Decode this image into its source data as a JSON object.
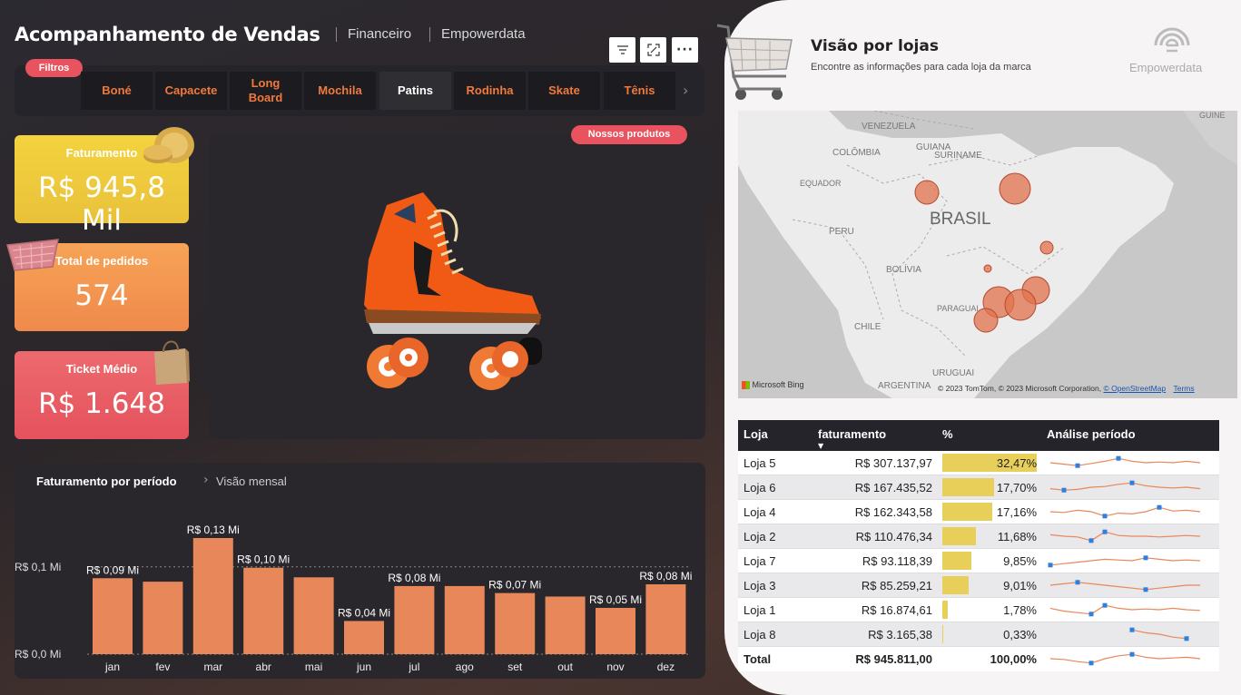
{
  "header": {
    "title": "Acompanhamento de Vendas",
    "crumbs": [
      "Financeiro",
      "Empowerdata"
    ]
  },
  "filters": {
    "badge": "Filtros",
    "tabs": [
      "Boné",
      "Capacete",
      "Long Board",
      "Mochila",
      "Patins",
      "Rodinha",
      "Skate",
      "Tênis"
    ],
    "active": "Patins"
  },
  "kpis": {
    "faturamento": {
      "label": "Faturamento",
      "value": "R$ 945,8 Mil"
    },
    "pedidos": {
      "label": "Total de pedidos",
      "value": "574"
    },
    "ticket": {
      "label": "Ticket Médio",
      "value": "R$ 1.648"
    }
  },
  "product": {
    "badge": "Nossos produtos"
  },
  "chart_panel": {
    "title": "Faturamento por período",
    "subtitle": "Visão mensal"
  },
  "chart_data": {
    "type": "bar",
    "categories": [
      "jan",
      "fev",
      "mar",
      "abr",
      "mai",
      "jun",
      "jul",
      "ago",
      "set",
      "out",
      "nov",
      "dez"
    ],
    "values": [
      0.087,
      0.083,
      0.133,
      0.099,
      0.088,
      0.038,
      0.078,
      0.078,
      0.07,
      0.066,
      0.053,
      0.08
    ],
    "data_labels": [
      "R$ 0,09 Mi",
      "",
      "R$ 0,13 Mi",
      "R$ 0,10 Mi",
      "",
      "R$ 0,04 Mi",
      "R$ 0,08 Mi",
      "",
      "R$ 0,07 Mi",
      "",
      "R$ 0,05 Mi",
      "R$ 0,08 Mi"
    ],
    "ytick_labels": [
      "R$ 0,0 Mi",
      "R$ 0,1 Mi"
    ],
    "yticks": [
      0,
      0.1
    ],
    "ylim": [
      0,
      0.133
    ],
    "color": "#e8885a"
  },
  "right": {
    "title": "Visão por lojas",
    "subtitle": "Encontre as informações para cada loja da marca",
    "brand": "Empowerdata"
  },
  "map": {
    "labels": [
      "VENEZUELA",
      "COLÔMBIA",
      "GUIANA",
      "SURINAME",
      "GUINE",
      "EQUADOR",
      "PERU",
      "BRASIL",
      "BOLÍVIA",
      "PARAGUAI",
      "CHILE",
      "ARGENTINA",
      "URUGUAI"
    ],
    "provider": "Microsoft Bing",
    "attribution": "© 2023 TomTom, © 2023 Microsoft Corporation,",
    "osm": "© OpenStreetMap",
    "terms": "Terms"
  },
  "table": {
    "headers": [
      "Loja",
      "faturamento",
      "%",
      "Análise período"
    ],
    "rows": [
      {
        "loja": "Loja 5",
        "fat": "R$ 307.137,97",
        "pct": "32,47%",
        "p": 32.47
      },
      {
        "loja": "Loja 6",
        "fat": "R$ 167.435,52",
        "pct": "17,70%",
        "p": 17.7
      },
      {
        "loja": "Loja 4",
        "fat": "R$ 162.343,58",
        "pct": "17,16%",
        "p": 17.16
      },
      {
        "loja": "Loja 2",
        "fat": "R$ 110.476,34",
        "pct": "11,68%",
        "p": 11.68
      },
      {
        "loja": "Loja 7",
        "fat": "R$ 93.118,39",
        "pct": "9,85%",
        "p": 9.85
      },
      {
        "loja": "Loja 3",
        "fat": "R$ 85.259,21",
        "pct": "9,01%",
        "p": 9.01
      },
      {
        "loja": "Loja 1",
        "fat": "R$ 16.874,61",
        "pct": "1,78%",
        "p": 1.78
      },
      {
        "loja": "Loja 8",
        "fat": "R$ 3.165,38",
        "pct": "0,33%",
        "p": 0.33
      }
    ],
    "total": {
      "label": "Total",
      "fat": "R$ 945.811,00",
      "pct": "100,00%"
    }
  }
}
